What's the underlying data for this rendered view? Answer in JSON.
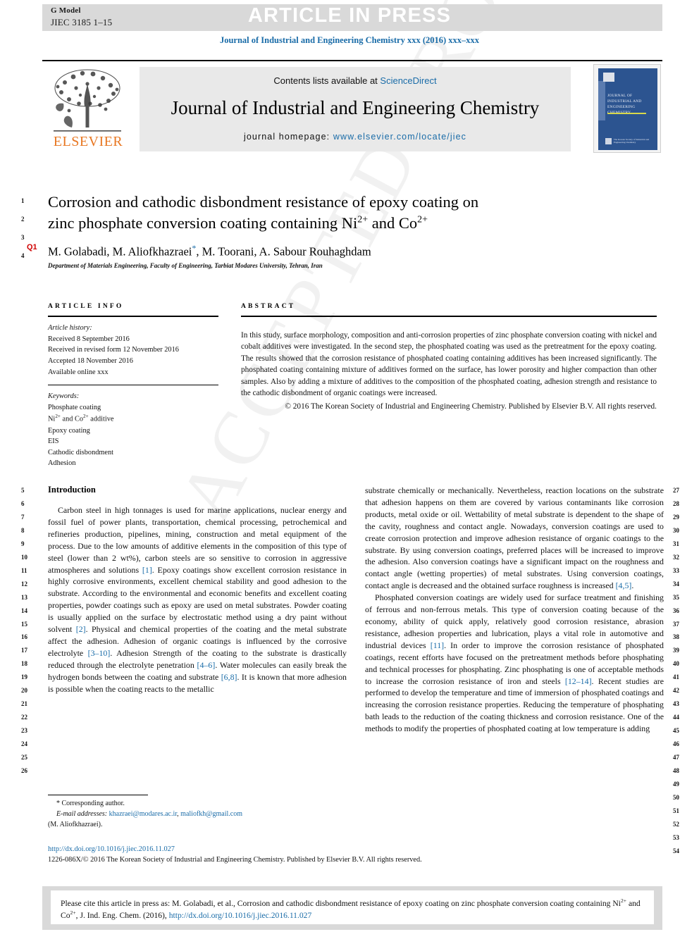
{
  "header": {
    "g_model_label": "G Model",
    "g_model_id": "JIEC 3185 1–15",
    "article_in_press": "ARTICLE IN PRESS",
    "journal_reference": "Journal of Industrial and Engineering Chemistry xxx (2016) xxx–xxx"
  },
  "masthead": {
    "contents_prefix": "Contents lists available at ",
    "sciencedirect": "ScienceDirect",
    "journal_title": "Journal of Industrial and Engineering Chemistry",
    "homepage_prefix": "journal homepage: ",
    "homepage_url": "www.elsevier.com/locate/jiec",
    "elsevier_wordmark": "ELSEVIER",
    "elsevier_color": "#e87722",
    "cover_title": "Journal of Industrial and Engineering Chemistry",
    "cover_society": "The Korean Society of Industrial and Engineering Chemistry",
    "cover_color": "#2c5490"
  },
  "article": {
    "title_line1": "Corrosion and cathodic disbondment resistance of epoxy coating on",
    "title_line2_a": "zinc phosphate conversion coating containing Ni",
    "title_sup1": "2+",
    "title_line2_b": " and Co",
    "title_sup2": "2+",
    "query_tag": "Q1",
    "authors": "M. Golabadi, M. Aliofkhazraei",
    "authors_rest": ", M. Toorani, A. Sabour Rouhaghdam",
    "corresponding_marker": "*",
    "affiliation": "Department of Materials Engineering, Faculty of Engineering, Tarbiat Modares University, Tehran, Iran"
  },
  "article_info": {
    "heading": "ARTICLE INFO",
    "history_label": "Article history:",
    "history": [
      "Received 8 September 2016",
      "Received in revised form 12 November 2016",
      "Accepted 18 November 2016",
      "Available online xxx"
    ],
    "keywords_label": "Keywords:",
    "keywords": [
      "Phosphate coating",
      "Ni2+ and Co2+ additive",
      "Epoxy coating",
      "EIS",
      "Cathodic disbondment",
      "Adhesion"
    ]
  },
  "abstract": {
    "heading": "ABSTRACT",
    "text": "In this study, surface morphology, composition and anti-corrosion properties of zinc phosphate conversion coating with nickel and cobalt additives were investigated. In the second step, the phosphated coating was used as the pretreatment for the epoxy coating. The results showed that the corrosion resistance of phosphated coating containing additives has been increased significantly. The phosphated coating containing mixture of additives formed on the surface, has lower porosity and higher compaction than other samples. Also by adding a mixture of additives to the composition of the phosphated coating, adhesion strength and resistance to the cathodic disbondment of organic coatings were increased.",
    "copyright": "© 2016 The Korean Society of Industrial and Engineering Chemistry. Published by Elsevier B.V. All rights reserved."
  },
  "body": {
    "intro_heading": "Introduction",
    "left_para_1_p1": "Carbon steel in high tonnages is used for marine applications, nuclear energy and fossil fuel of power plants, transportation, chemical processing, petrochemical and refineries production, pipelines, mining, construction and metal equipment of the process. Due to the low amounts of additive elements in the composition of this type of steel (lower than 2 wt%), carbon steels are so sensitive to corrosion in aggressive atmospheres and solutions ",
    "ref_1": "[1]",
    "left_para_1_p2": ". Epoxy coatings show excellent corrosion resistance in highly corrosive environments, excellent chemical stability and good adhesion to the substrate. According to the environmental and economic benefits and excellent coating properties, powder coatings such as epoxy are used on metal substrates. Powder coating is usually applied on the surface by electrostatic method using a dry paint without solvent ",
    "ref_2": "[2]",
    "left_para_1_p3": ". Physical and chemical properties of the coating and the metal substrate affect the adhesion. Adhesion of organic coatings is influenced by the corrosive electrolyte ",
    "ref_3": "[3–10]",
    "left_para_1_p4": ". Adhesion Strength of the coating to the substrate is drastically reduced through the electrolyte penetration ",
    "ref_4": "[4–6]",
    "left_para_1_p5": ". Water molecules can easily break the hydrogen bonds between the coating and substrate ",
    "ref_5": "[6,8]",
    "left_para_1_p6": ". It is known that more adhesion is possible when the coating reacts to the metallic",
    "right_para_1_p1": "substrate chemically or mechanically. Nevertheless, reaction locations on the substrate that adhesion happens on them are covered by various contaminants like corrosion products, metal oxide or oil. Wettability of metal substrate is dependent to the shape of the cavity, roughness and contact angle. Nowadays, conversion coatings are used to create corrosion protection and improve adhesion resistance of organic coatings to the substrate. By using conversion coatings, preferred places will be increased to improve the adhesion. Also conversion coatings have a significant impact on the roughness and contact angle (wetting properties) of metal substrates. Using conversion coatings, contact angle is decreased and the obtained surface roughness is increased ",
    "ref_6": "[4,5]",
    "right_para_1_p2": ".",
    "right_para_2_p1": "Phosphated conversion coatings are widely used for surface treatment and finishing of ferrous and non-ferrous metals. This type of conversion coating because of the economy, ability of quick apply, relatively good corrosion resistance, abrasion resistance, adhesion properties and lubrication, plays a vital role in automotive and industrial devices ",
    "ref_7": "[11]",
    "right_para_2_p2": ". In order to improve the corrosion resistance of phosphated coatings, recent efforts have focused on the pretreatment methods before phosphating and technical processes for phosphating. Zinc phosphating is one of acceptable methods to increase the corrosion resistance of iron and steels ",
    "ref_8": "[12–14]",
    "right_para_2_p3": ". Recent studies are performed to develop the temperature and time of immersion of phosphated coatings and increasing the corrosion resistance properties. Reducing the temperature of phosphating bath leads to the reduction of the coating thickness and corrosion resistance. One of the methods to modify the properties of phosphated coating at low temperature is adding"
  },
  "footnote": {
    "corresponding": "* Corresponding author.",
    "email_label": "E-mail addresses:",
    "email_1": "khazraei@modares.ac.ir",
    "email_sep": ", ",
    "email_2": "maliofkh@gmail.com",
    "email_owner": "(M. Aliofkhazraei)."
  },
  "bottom_meta": {
    "doi": "http://dx.doi.org/10.1016/j.jiec.2016.11.027",
    "issn_line": "1226-086X/© 2016 The Korean Society of Industrial and Engineering Chemistry. Published by Elsevier B.V. All rights reserved."
  },
  "cite_box": {
    "prefix": "Please cite this article in press as: M. Golabadi, et al., Corrosion and cathodic disbondment resistance of epoxy coating on zinc phosphate conversion coating containing Ni",
    "sup1": "2+",
    "mid": " and Co",
    "sup2": "2+",
    "suffix": ", J. Ind. Eng. Chem. (2016), ",
    "doi": "http://dx.doi.org/10.1016/j.jiec.2016.11.027"
  },
  "watermark": {
    "text": "ACCEPTED PROOF"
  },
  "line_numbers": {
    "title_block": [
      "1",
      "2",
      "3",
      "4"
    ],
    "left_column": [
      "5",
      "6",
      "7",
      "8",
      "9",
      "10",
      "11",
      "12",
      "13",
      "14",
      "15",
      "16",
      "17",
      "18",
      "19",
      "20",
      "21",
      "22",
      "23",
      "24",
      "25",
      "26"
    ],
    "right_column": [
      "27",
      "28",
      "29",
      "30",
      "31",
      "32",
      "33",
      "34",
      "35",
      "36",
      "37",
      "38",
      "39",
      "40",
      "41",
      "42",
      "43",
      "44",
      "45",
      "46",
      "47",
      "48",
      "49",
      "50",
      "51",
      "52",
      "53",
      "54"
    ]
  },
  "colors": {
    "link": "#1a6ca8",
    "query_red": "#d00000",
    "bar_grey": "#d9d9d9"
  }
}
